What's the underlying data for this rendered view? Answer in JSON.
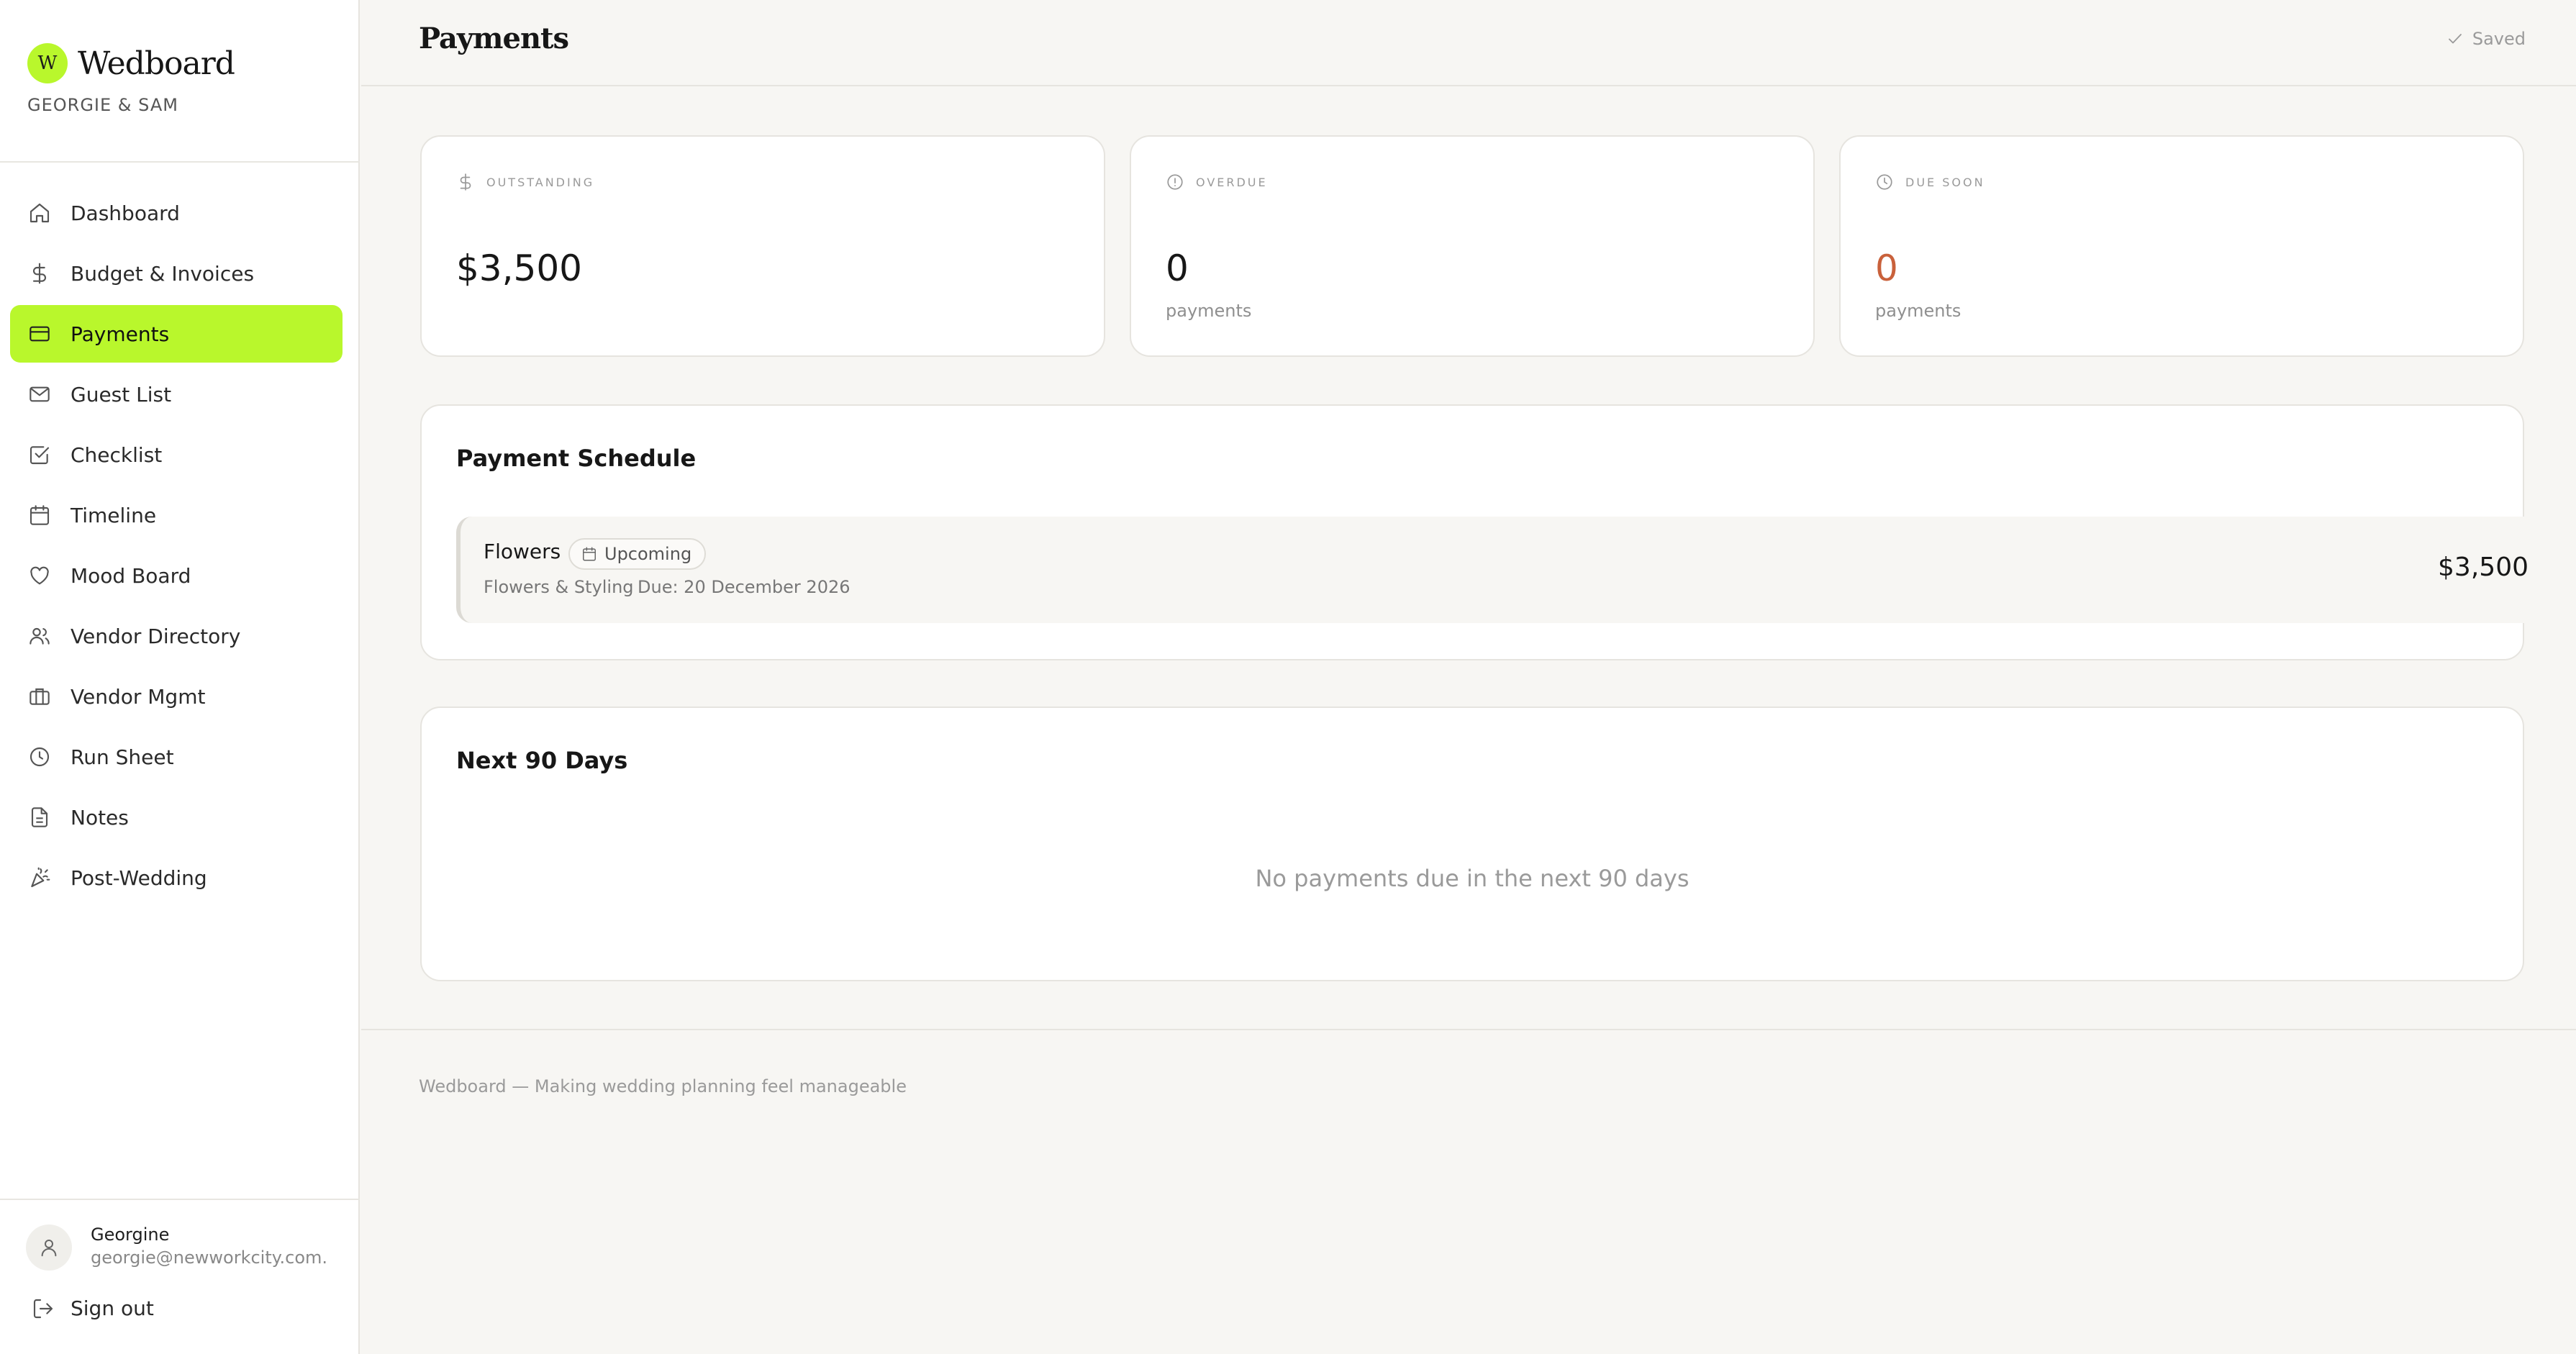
{
  "brand": {
    "logo_letter": "W",
    "name": "Wedboard",
    "couple": "GEORGIE & SAM",
    "accent": "#b9f72c"
  },
  "nav": {
    "items": [
      {
        "label": "Dashboard",
        "icon": "home-icon"
      },
      {
        "label": "Budget & Invoices",
        "icon": "dollar-icon"
      },
      {
        "label": "Payments",
        "icon": "credit-card-icon",
        "active": true
      },
      {
        "label": "Guest List",
        "icon": "mail-icon"
      },
      {
        "label": "Checklist",
        "icon": "checkbox-icon"
      },
      {
        "label": "Timeline",
        "icon": "calendar-icon"
      },
      {
        "label": "Mood Board",
        "icon": "heart-icon"
      },
      {
        "label": "Vendor Directory",
        "icon": "users-icon"
      },
      {
        "label": "Vendor Mgmt",
        "icon": "briefcase-icon"
      },
      {
        "label": "Run Sheet",
        "icon": "clock-icon"
      },
      {
        "label": "Notes",
        "icon": "document-icon"
      },
      {
        "label": "Post-Wedding",
        "icon": "party-popper-icon"
      }
    ]
  },
  "user": {
    "name": "Georgine",
    "email": "georgie@newworkcity.com...."
  },
  "signout_label": "Sign out",
  "header": {
    "title": "Payments",
    "save_status": "Saved"
  },
  "stats": {
    "outstanding": {
      "label": "OUTSTANDING",
      "value": "$3,500"
    },
    "overdue": {
      "label": "OVERDUE",
      "value": "0",
      "unit": "payments"
    },
    "due_soon": {
      "label": "DUE SOON",
      "value": "0",
      "unit": "payments",
      "color": "#c9613b"
    }
  },
  "schedule": {
    "title": "Payment Schedule",
    "payments": [
      {
        "name": "Flowers",
        "status": "Upcoming",
        "category": "Flowers & Styling",
        "due": "Due: 20 December 2026",
        "amount": "$3,500"
      }
    ]
  },
  "next90": {
    "title": "Next 90 Days",
    "empty_message": "No payments due in the next 90 days"
  },
  "footer": {
    "text": "Wedboard — Making wedding planning feel manageable"
  }
}
